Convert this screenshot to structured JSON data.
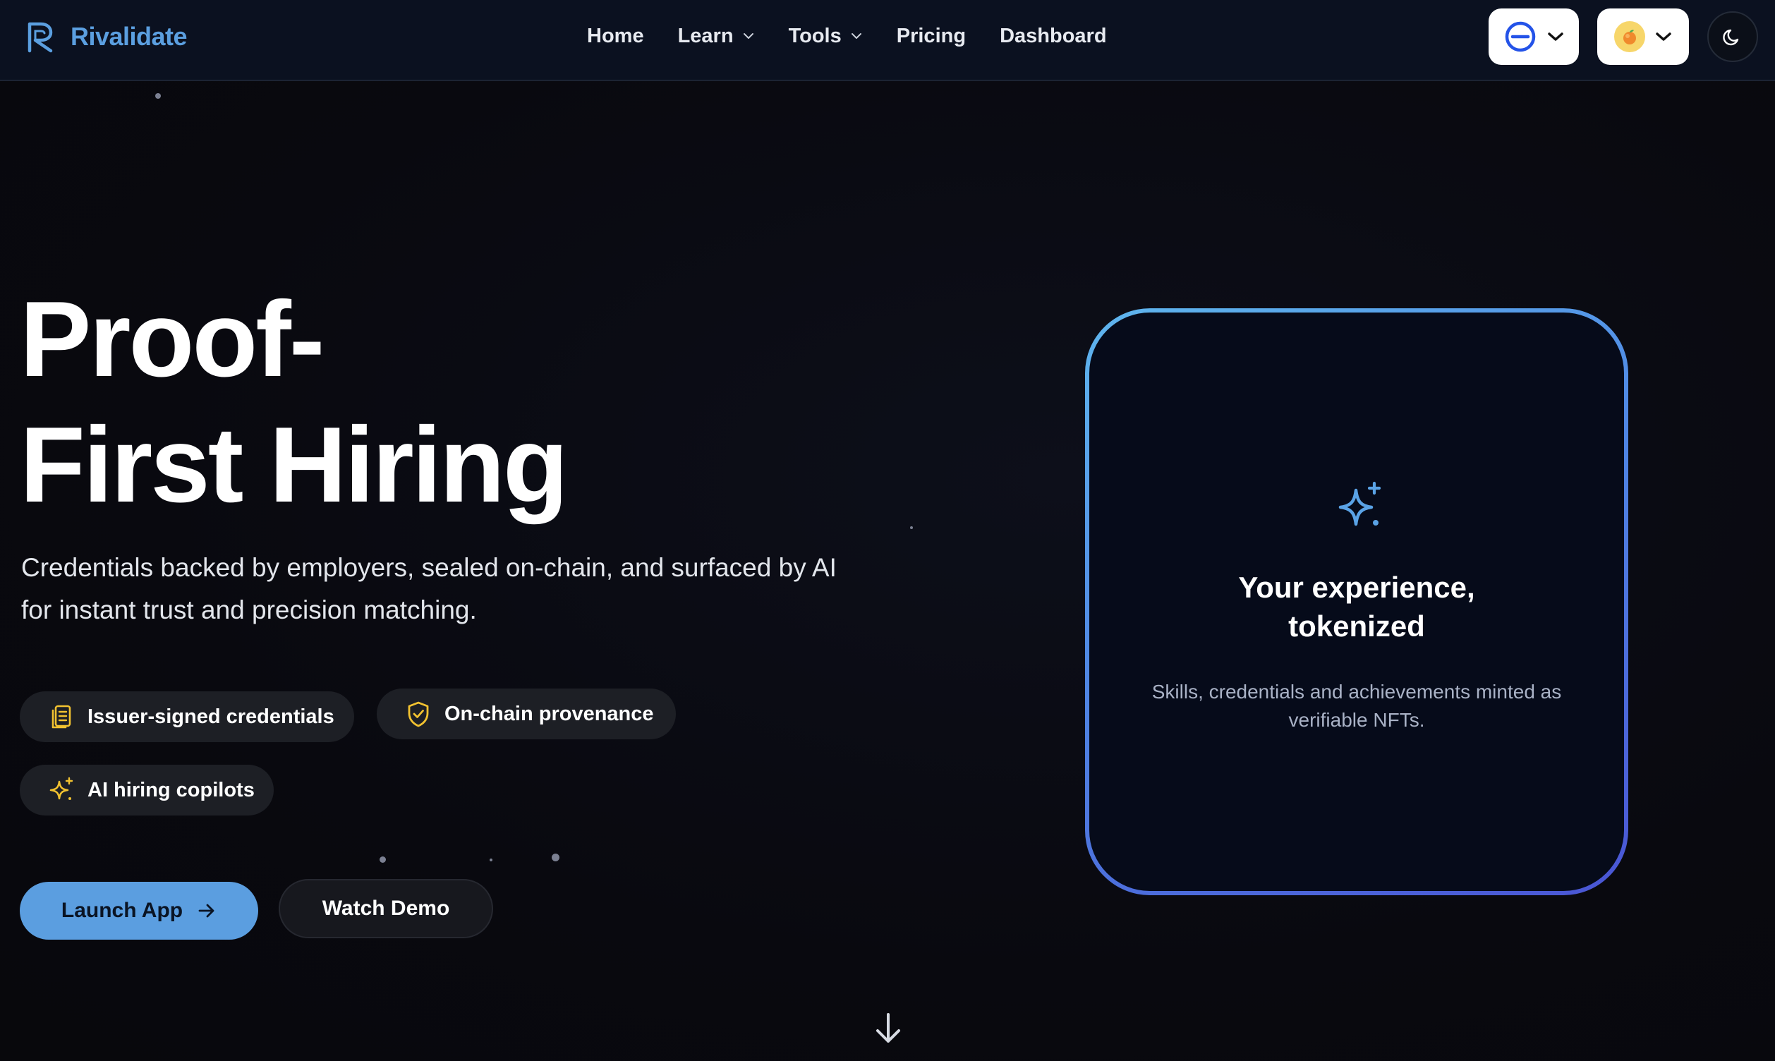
{
  "brand": {
    "name": "Rivalidate",
    "logo_icon": "r-monogram-icon",
    "accent_color": "#5b9fe0"
  },
  "nav": {
    "items": [
      {
        "label": "Home",
        "has_dropdown": false
      },
      {
        "label": "Learn",
        "has_dropdown": true
      },
      {
        "label": "Tools",
        "has_dropdown": true
      },
      {
        "label": "Pricing",
        "has_dropdown": false
      },
      {
        "label": "Dashboard",
        "has_dropdown": false
      }
    ]
  },
  "header_actions": {
    "network_select_icon": "network-circle-icon",
    "wallet_select_icon": "peach-avatar-icon",
    "theme_toggle_icon": "moon-icon"
  },
  "hero": {
    "title_line1": "Proof-",
    "title_line2": "First Hiring",
    "subtitle": "Credentials backed by employers, sealed on-chain, and surfaced by AI for instant trust and precision matching.",
    "chips": [
      {
        "label": "Issuer-signed credentials",
        "icon": "document-stack-icon"
      },
      {
        "label": "On-chain provenance",
        "icon": "shield-check-icon"
      },
      {
        "label": "AI hiring copilots",
        "icon": "sparkles-icon"
      }
    ],
    "primary_button": "Launch App",
    "secondary_button": "Watch Demo"
  },
  "card": {
    "icon": "sparkles-icon",
    "title_line1": "Your experience,",
    "title_line2": "tokenized",
    "description": "Skills, credentials and achievements minted as verifiable NFTs."
  },
  "colors": {
    "background": "#0a0a10",
    "navbar": "#0b1120",
    "primary_button": "#5b9ee0",
    "chip_icon": "#f2c230",
    "card_gradient_start": "#5fb6ee",
    "card_gradient_end": "#4a55d4"
  }
}
